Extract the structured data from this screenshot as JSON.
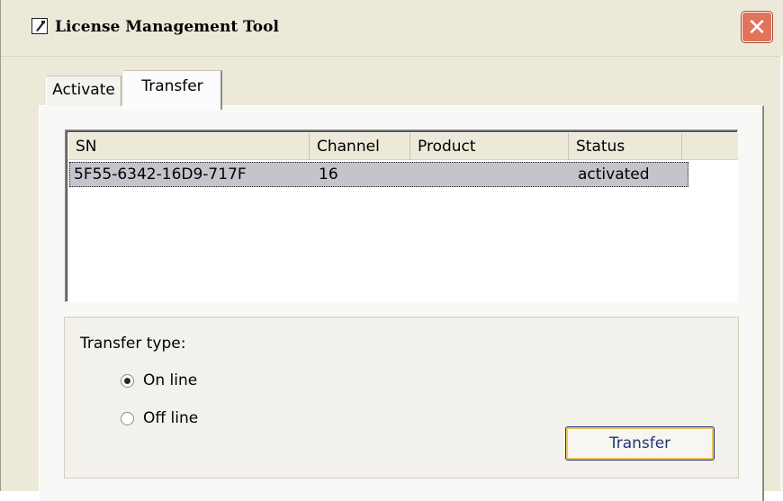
{
  "window": {
    "title": "License Management Tool",
    "close_glyph": "✕"
  },
  "tabs": [
    {
      "label": "Activate",
      "selected": false
    },
    {
      "label": "Transfer",
      "selected": true
    }
  ],
  "list": {
    "columns": [
      "SN",
      "Channel",
      "Product",
      "Status"
    ],
    "rows": [
      {
        "sn": "5F55-6342-16D9-717F",
        "channel": "16",
        "product": "",
        "status": "activated",
        "selected": true
      }
    ]
  },
  "transfer_type": {
    "label": "Transfer type:",
    "options": [
      {
        "label": "On line",
        "checked": true
      },
      {
        "label": "Off line",
        "checked": false
      }
    ]
  },
  "buttons": {
    "transfer_label": "Transfer"
  },
  "colors": {
    "window_bg": "#ece9d8",
    "close_button": "#e2735a",
    "selection": "#c4c4cc",
    "button_focus": "#f2c35c"
  }
}
